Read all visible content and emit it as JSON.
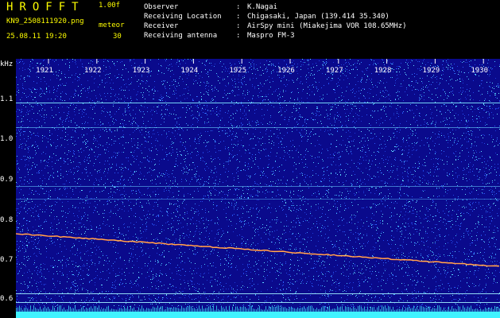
{
  "header": {
    "logo": "HROFFT",
    "version": "1.00f",
    "filename": "KN9_2508111920.png",
    "mode_label": "meteor",
    "datetime": "25.08.11 19:20",
    "mode_value": "30"
  },
  "station_info": [
    {
      "key": "Observer",
      "value": "K.Nagai"
    },
    {
      "key": "Receiving Location",
      "value": "Chigasaki, Japan (139.414 35.340)"
    },
    {
      "key": "Receiver",
      "value": "AirSpy mini (Miakejima VOR 108.65MHz)"
    },
    {
      "key": "Receiving antenna",
      "value": "Maspro FM-3"
    }
  ],
  "axis": {
    "unit": "kHz",
    "x_ticks": [
      "1921",
      "1922",
      "1923",
      "1924",
      "1925",
      "1926",
      "1927",
      "1928",
      "1929",
      "1930"
    ],
    "y_ticks": [
      "1.1",
      "1.0",
      "0.9",
      "0.8",
      "0.7",
      "0.6"
    ]
  },
  "colors": {
    "background": "#0a0a8c",
    "noise": "#2c5cff",
    "header_text": "#fcfc00",
    "trace": "#ff4040",
    "bottom_band": "#3ff3ff"
  }
}
